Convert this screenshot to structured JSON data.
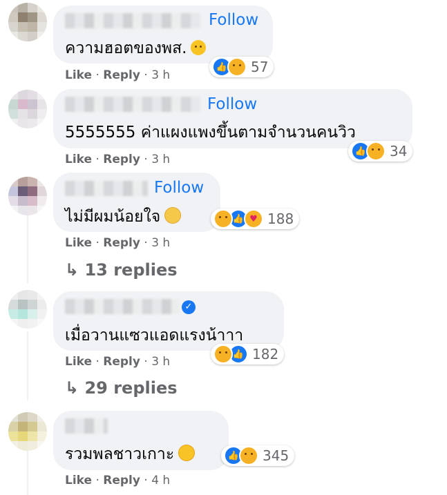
{
  "comments": [
    {
      "follow": "Follow",
      "text": "ความฮอตของพส.",
      "count": "57",
      "like": "Like",
      "reply": "Reply",
      "time": "3 h"
    },
    {
      "follow": "Follow",
      "text": "5555555 ค่าแผงแพงขึ้นตามจำนวนคนวิว",
      "count": "34",
      "like": "Like",
      "reply": "Reply",
      "time": "3 h"
    },
    {
      "follow": "Follow",
      "text": "ไม่มีผมน้อยใจ",
      "count": "188",
      "like": "Like",
      "reply": "Reply",
      "time": "3 h",
      "replies": "13 replies"
    },
    {
      "follow": "",
      "text": "เมื่อวานแซวแอดแรงน้าาา",
      "count": "182",
      "like": "Like",
      "reply": "Reply",
      "time": "3 h",
      "replies": "29 replies"
    },
    {
      "follow": "",
      "text": "รวมพลชาวเกาะ",
      "count": "345",
      "like": "Like",
      "reply": "Reply",
      "time": "4 h"
    }
  ],
  "colors": {
    "link": "#1877f2",
    "muted": "#65676b",
    "bubble": "#f0f2f5"
  }
}
